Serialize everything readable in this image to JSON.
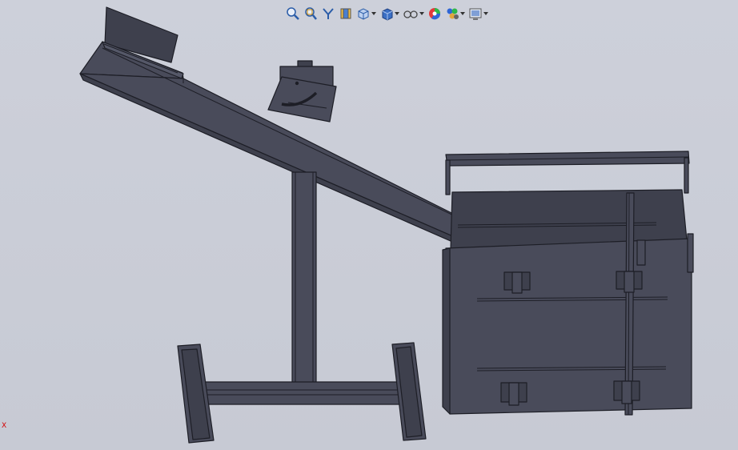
{
  "toolbar": {
    "buttons": [
      {
        "icon": "zoom-to-fit-icon",
        "dropdown": false
      },
      {
        "icon": "zoom-to-area-icon",
        "dropdown": false
      },
      {
        "icon": "previous-view-icon",
        "dropdown": false
      },
      {
        "icon": "section-view-icon",
        "dropdown": false
      },
      {
        "icon": "view-orientation-icon",
        "dropdown": true
      },
      {
        "icon": "display-style-icon",
        "dropdown": true
      },
      {
        "icon": "hide-show-items-icon",
        "dropdown": true
      },
      {
        "icon": "edit-appearance-icon",
        "dropdown": false
      },
      {
        "icon": "apply-scene-icon",
        "dropdown": true
      },
      {
        "icon": "view-settings-icon",
        "dropdown": true
      }
    ]
  },
  "triad": {
    "axis_label": "X",
    "axis_color": "#d40000"
  },
  "colors": {
    "background": "#c9ccd6",
    "part_fill": "#494b5a",
    "part_edge": "#1d1e26"
  }
}
